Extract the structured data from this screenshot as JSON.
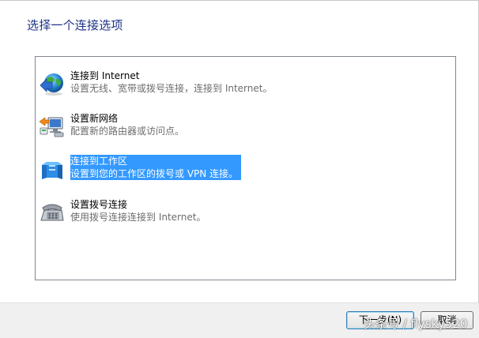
{
  "dialog": {
    "heading": "选择一个连接选项"
  },
  "options": [
    {
      "label": "连接到 Internet",
      "description": "设置无线、宽带或拨号连接，连接到 Internet。",
      "icon": "globe-network-icon"
    },
    {
      "label": "设置新网络",
      "description": "配置新的路由器或访问点。",
      "icon": "new-network-icon"
    },
    {
      "label": "连接到工作区",
      "description": "设置到您的工作区的拨号或 VPN 连接。",
      "icon": "workplace-icon",
      "selected": true
    },
    {
      "label": "设置拨号连接",
      "description": "使用拨号连接连接到 Internet。",
      "icon": "dialup-phone-icon"
    }
  ],
  "buttons": {
    "next_label": "下一步(N)",
    "cancel_label": "取消"
  },
  "watermark": {
    "text": "头条号 / flysky520"
  },
  "colors": {
    "heading": "#1e3287",
    "selection": "#3399ff",
    "description": "#6d6d6d",
    "footer": "#f0f0f0"
  }
}
